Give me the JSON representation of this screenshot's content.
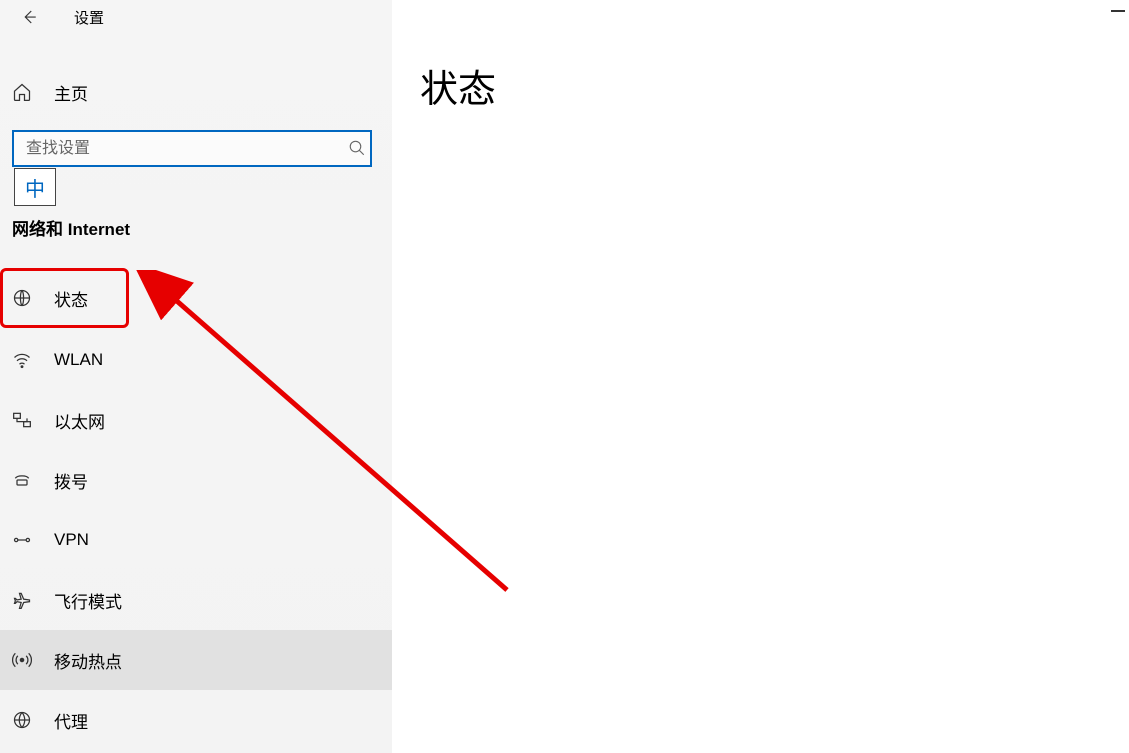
{
  "header": {
    "title": "设置"
  },
  "home": {
    "label": "主页"
  },
  "search": {
    "placeholder": "查找设置"
  },
  "ime": {
    "label": "中"
  },
  "section": {
    "title": "网络和 Internet"
  },
  "nav": {
    "items": [
      {
        "label": "状态",
        "icon": "status"
      },
      {
        "label": "WLAN",
        "icon": "wifi"
      },
      {
        "label": "以太网",
        "icon": "ethernet"
      },
      {
        "label": "拨号",
        "icon": "dialup"
      },
      {
        "label": "VPN",
        "icon": "vpn"
      },
      {
        "label": "飞行模式",
        "icon": "airplane"
      },
      {
        "label": "移动热点",
        "icon": "hotspot"
      },
      {
        "label": "代理",
        "icon": "proxy"
      }
    ]
  },
  "main": {
    "heading": "状态"
  }
}
